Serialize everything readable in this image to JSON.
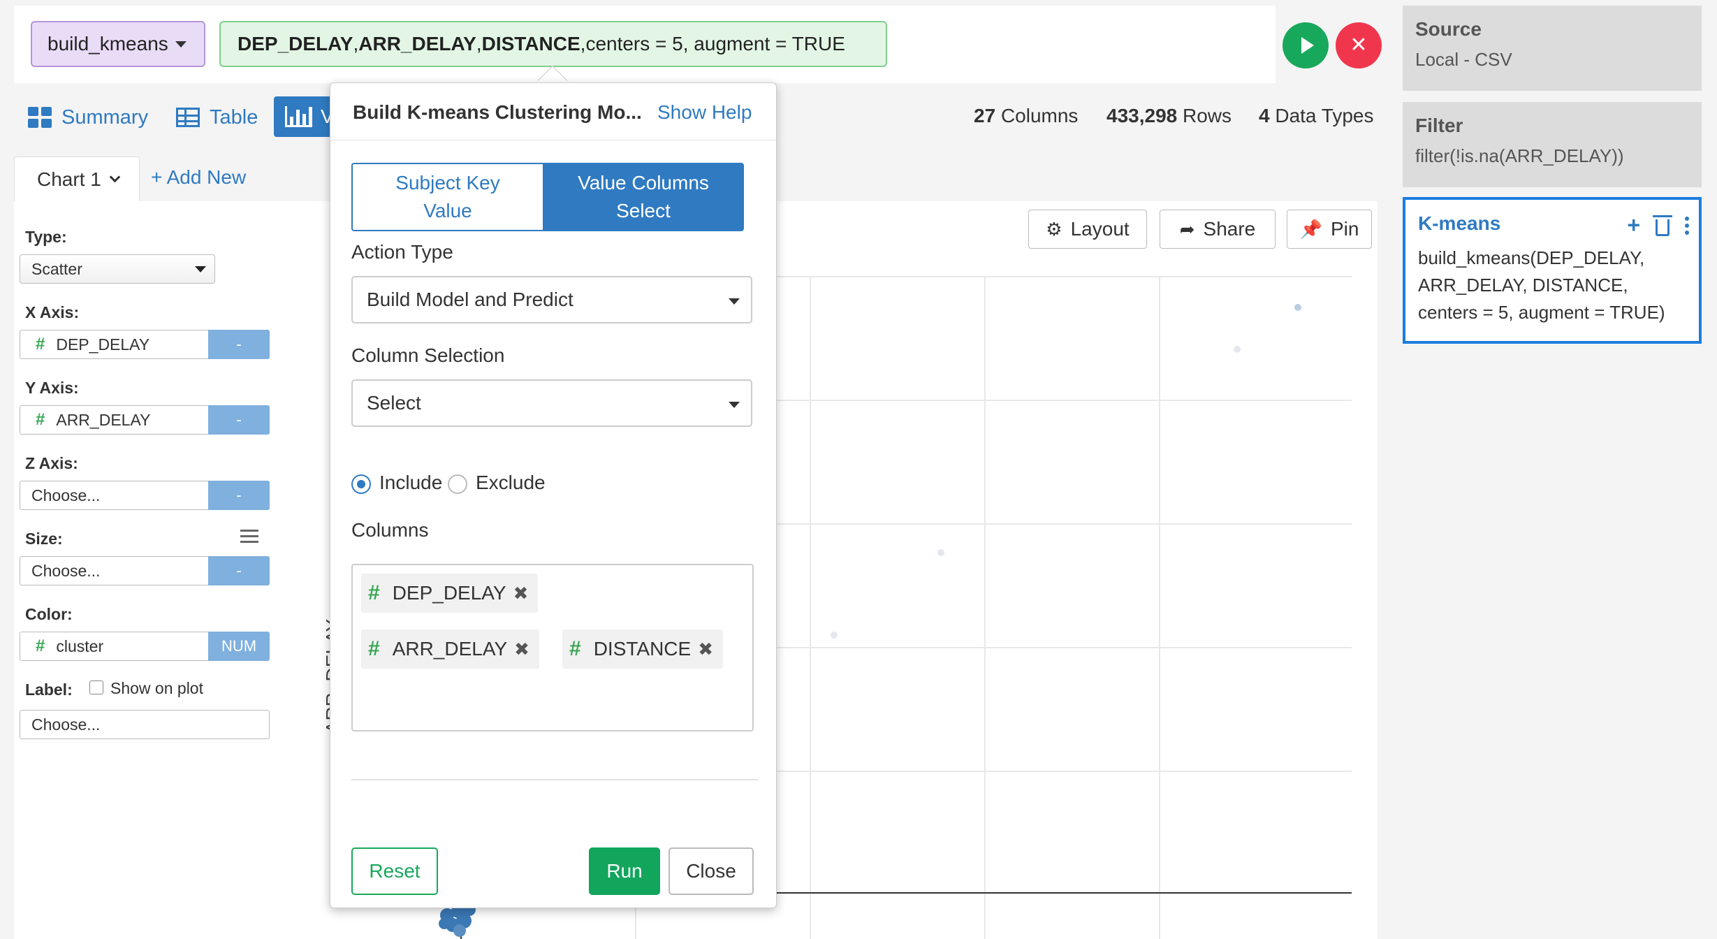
{
  "command": {
    "function": "build_kmeans",
    "args_bold": [
      "DEP_DELAY",
      "ARR_DELAY",
      "DISTANCE"
    ],
    "args_rest": "centers = 5, augment = TRUE",
    "sep": ", "
  },
  "view_tabs": {
    "summary": "Summary",
    "table": "Table",
    "viz_partial": "V"
  },
  "stats": {
    "columns_count": "27",
    "columns_label": "Columns",
    "rows_count": "433,298",
    "rows_label": "Rows",
    "types_count": "4",
    "types_label": "Data Types"
  },
  "chart_tabs": {
    "active": "Chart 1",
    "add_new": "+ Add New"
  },
  "config": {
    "type_label": "Type:",
    "type_value": "Scatter",
    "x_label": "X Axis:",
    "x_value": "DEP_DELAY",
    "x_side": "-",
    "y_label": "Y Axis:",
    "y_value": "ARR_DELAY",
    "y_side": "-",
    "z_label": "Z Axis:",
    "z_value": "Choose...",
    "z_side": "-",
    "size_label": "Size:",
    "size_value": "Choose...",
    "size_side": "-",
    "color_label": "Color:",
    "color_value": "cluster",
    "color_side": "NUM",
    "label_label": "Label:",
    "show_on_plot": "Show on plot",
    "label_value": "Choose..."
  },
  "toolbar": {
    "layout": "Layout",
    "share": "Share",
    "pin": "Pin"
  },
  "plot": {
    "ylabel_partial": "ARR_DELAY"
  },
  "steps": {
    "source": {
      "title": "Source",
      "body": "Local - CSV"
    },
    "filter": {
      "title": "Filter",
      "body": "filter(!is.na(ARR_DELAY))"
    },
    "kmeans": {
      "title": "K-means",
      "body_lines": [
        "build_kmeans(DEP_DELAY,",
        "ARR_DELAY, DISTANCE,",
        "centers = 5, augment = TRUE)"
      ]
    }
  },
  "popover": {
    "title": "Build K-means Clustering Mo...",
    "help": "Show Help",
    "seg_left": [
      "Subject Key",
      "Value"
    ],
    "seg_right": [
      "Value Columns",
      "Select"
    ],
    "action_type_label": "Action Type",
    "action_type_value": "Build Model and Predict",
    "column_selection_label": "Column Selection",
    "column_selection_value": "Select",
    "include_label": "Include",
    "exclude_label": "Exclude",
    "columns_label": "Columns",
    "chips": [
      "DEP_DELAY",
      "ARR_DELAY",
      "DISTANCE"
    ],
    "reset": "Reset",
    "run": "Run",
    "close": "Close"
  },
  "colors": {
    "accent": "#2f7ac1",
    "run_green": "#18a85c",
    "cancel_red": "#f0364d",
    "cmd_purple": "#e9dcf7",
    "cmd_green": "#e3f6e5",
    "active_step_border": "#1b7de0"
  },
  "icons": {
    "summary": "grid-icon",
    "table": "table-icon",
    "viz": "bar-chart-icon",
    "layout": "gear-icon",
    "share": "share-icon",
    "pin": "pin-icon",
    "run": "play-icon",
    "cancel": "close-icon",
    "add_step": "plus-icon",
    "delete_step": "trash-icon",
    "step_menu": "kebab-icon",
    "remove_chip": "close-icon"
  }
}
